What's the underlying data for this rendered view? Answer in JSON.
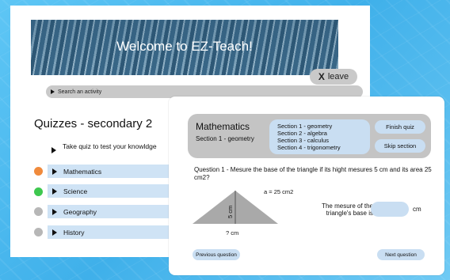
{
  "back_window": {
    "banner_title": "Welcome to EZ-Teach!",
    "leave_button": {
      "icon": "X",
      "label": "leave"
    },
    "search_placeholder": "Search an activity",
    "list_title": "Quizzes - secondary 2",
    "take_quiz_text": "Take quiz to test your knowldge",
    "subjects": [
      {
        "label": "Mathematics",
        "status_color": "#f08a3c"
      },
      {
        "label": "Science",
        "status_color": "#3ec84f"
      },
      {
        "label": "Geography",
        "status_color": "#b7b7b7"
      },
      {
        "label": "History",
        "status_color": "#b7b7b7"
      }
    ]
  },
  "quiz": {
    "subject": "Mathematics",
    "current_section": "Section 1 - geometry",
    "sections": [
      "Section 1 - geometry",
      "Section 2 - algebra",
      "Section 3 - calculus",
      "Section 4 - trigonometry"
    ],
    "finish_button": "Finish quiz",
    "skip_button": "Skip section",
    "question": "Question 1 - Mesure the base of the triangle if its hight mesures 5 cm and its area 25 cm2?",
    "area_label": "a = 25 cm2",
    "height_label": "5 cm",
    "base_label": "? cm",
    "answer_label": "The mesure of the triangle's base is",
    "answer_value": "",
    "answer_unit": "cm",
    "prev_button": "Previous question",
    "next_button": "Next question"
  },
  "colors": {
    "background": "#56bdf0",
    "accent_light_blue": "#c9def2",
    "header_gray": "#c4c4c4"
  }
}
